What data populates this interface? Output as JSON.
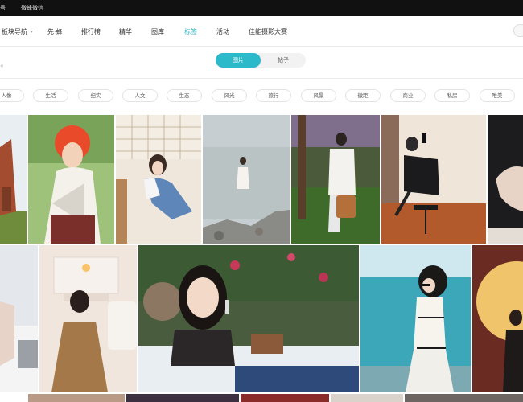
{
  "topbar": {
    "left_fragment": "号",
    "link": "微蜂微信"
  },
  "nav": {
    "items": [
      {
        "label": "板块导航",
        "has_caret": true
      },
      {
        "label": "先·蜂"
      },
      {
        "label": "排行榜"
      },
      {
        "label": "精华"
      },
      {
        "label": "图库"
      },
      {
        "label": "标签",
        "active": true
      },
      {
        "label": "活动"
      },
      {
        "label": "佳能摄影大赛"
      }
    ]
  },
  "view_toggle": {
    "options": [
      "图片",
      "帖子"
    ],
    "selected": "图片"
  },
  "tags": [
    "人像",
    "生活",
    "纪实",
    "人文",
    "生态",
    "风光",
    "旅行",
    "风景",
    "微距",
    "商业",
    "私房",
    "唯美"
  ],
  "colors": {
    "accent": "#2cb9c9",
    "topbar": "#111111"
  }
}
